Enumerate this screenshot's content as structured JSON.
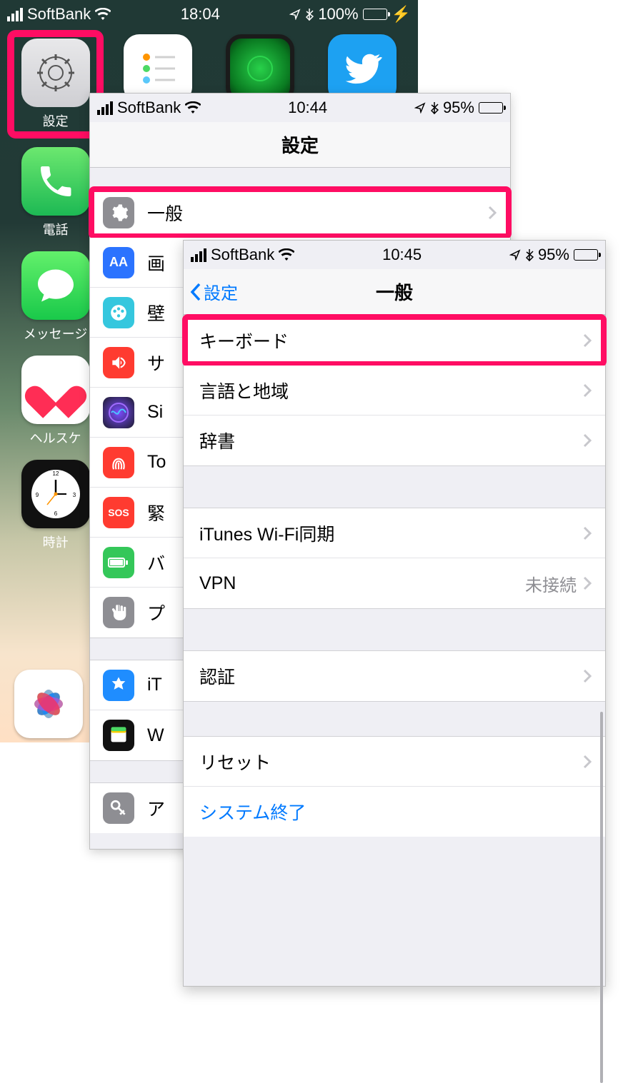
{
  "home": {
    "status": {
      "carrier": "SoftBank",
      "time": "18:04",
      "battery_pct": "100%"
    },
    "apps": {
      "settings": "設定",
      "phone": "電話",
      "messages": "メッセージ",
      "health": "ヘルスケ",
      "clock": "時計"
    }
  },
  "settings": {
    "status": {
      "carrier": "SoftBank",
      "time": "10:44",
      "battery_pct": "95%"
    },
    "title": "設定",
    "rows": {
      "general": "一般",
      "display": "画",
      "wallpaper": "壁",
      "sound": "サ",
      "siri": "Si",
      "touchid": "To",
      "sos": "緊",
      "sos_icon": "SOS",
      "battery": "バ",
      "privacy": "プ",
      "itunes": "iT",
      "wallet": "W",
      "passwords": "ア"
    }
  },
  "general": {
    "status": {
      "carrier": "SoftBank",
      "time": "10:45",
      "battery_pct": "95%"
    },
    "back": "設定",
    "title": "一般",
    "rows": {
      "keyboard": "キーボード",
      "language": "言語と地域",
      "dictionary": "辞書",
      "itunes_wifi": "iTunes Wi-Fi同期",
      "vpn": "VPN",
      "vpn_value": "未接続",
      "auth": "認証",
      "reset": "リセット",
      "shutdown": "システム終了"
    }
  }
}
